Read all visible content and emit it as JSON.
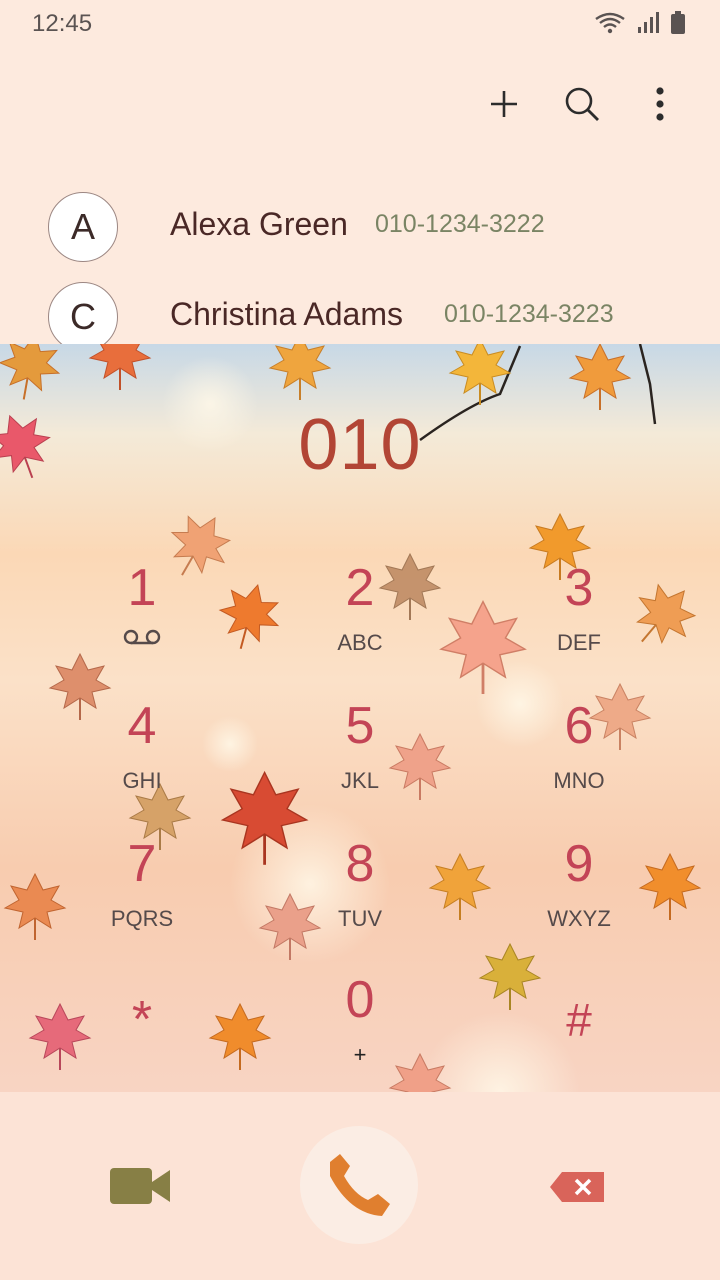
{
  "status": {
    "time": "12:45"
  },
  "actions": {
    "add_icon": "plus-icon",
    "search_icon": "search-icon",
    "more_icon": "more-vert-icon"
  },
  "contacts": [
    {
      "initial": "A",
      "name": "Alexa Green",
      "number": "010-1234-3222"
    },
    {
      "initial": "C",
      "name": "Christina Adams",
      "number": "010-1234-3223"
    }
  ],
  "dialpad": {
    "digits": "010",
    "keys": [
      {
        "num": "1",
        "letters": ""
      },
      {
        "num": "2",
        "letters": "ABC"
      },
      {
        "num": "3",
        "letters": "DEF"
      },
      {
        "num": "4",
        "letters": "GHI"
      },
      {
        "num": "5",
        "letters": "JKL"
      },
      {
        "num": "6",
        "letters": "MNO"
      },
      {
        "num": "7",
        "letters": "PQRS"
      },
      {
        "num": "8",
        "letters": "TUV"
      },
      {
        "num": "9",
        "letters": "WXYZ"
      },
      {
        "num": "*",
        "letters": ""
      },
      {
        "num": "0",
        "letters": "+"
      },
      {
        "num": "#",
        "letters": ""
      }
    ]
  },
  "colors": {
    "background": "#fdeade",
    "key_digit": "#c34456",
    "entered_digits": "#b24535",
    "call": "#e07f2f",
    "video": "#877f45",
    "delete": "#d9645a"
  }
}
